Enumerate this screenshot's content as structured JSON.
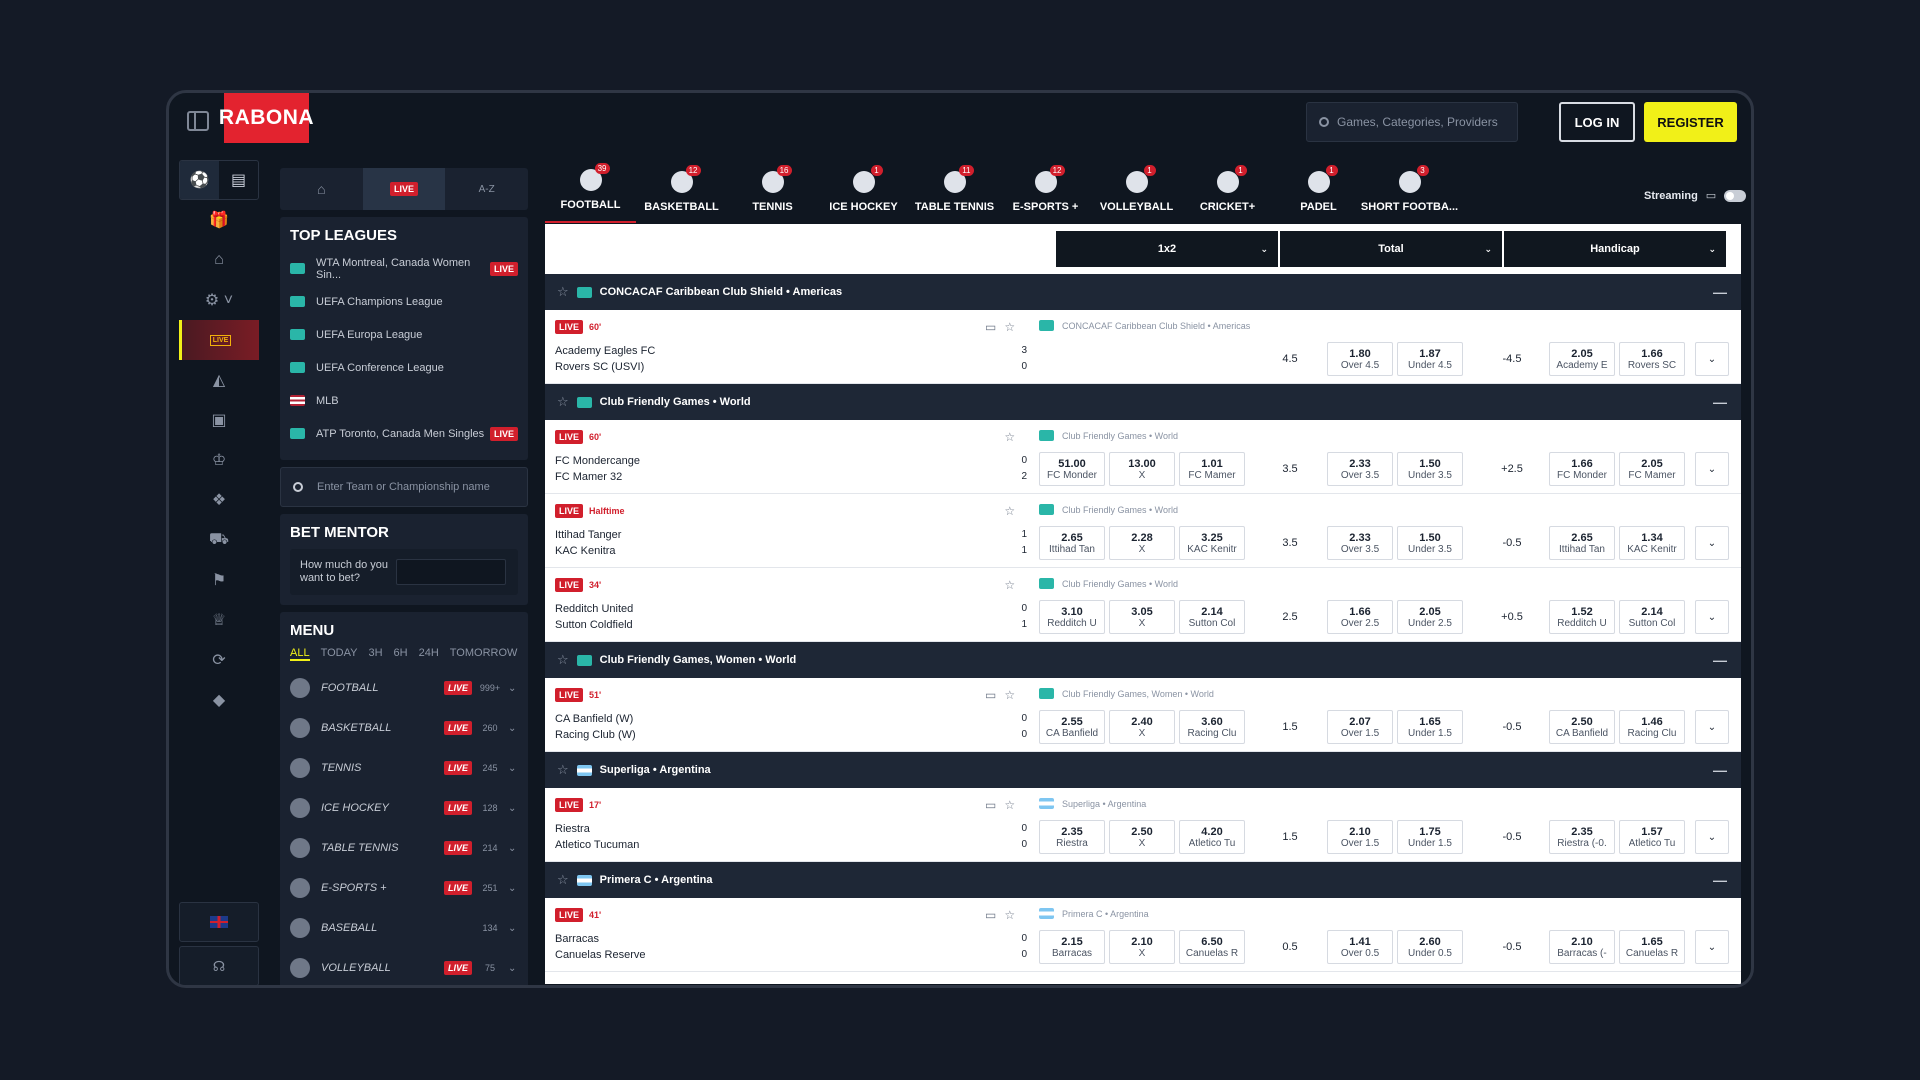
{
  "header": {
    "logo": "RABONA",
    "search_placeholder": "Games, Categories, Providers",
    "login": "LOG IN",
    "register": "REGISTER"
  },
  "sidebar": {
    "tabs": {
      "live": "LIVE",
      "az": "A-Z"
    },
    "top_leagues_title": "TOP LEAGUES",
    "top_leagues": [
      {
        "name": "WTA Montreal, Canada Women Sin...",
        "live": "LIVE"
      },
      {
        "name": "UEFA Champions League",
        "live": ""
      },
      {
        "name": "UEFA Europa League",
        "live": ""
      },
      {
        "name": "UEFA Conference League",
        "live": ""
      },
      {
        "name": "MLB",
        "live": ""
      },
      {
        "name": "ATP Toronto, Canada Men Singles",
        "live": "LIVE"
      }
    ],
    "team_search_placeholder": "Enter Team or Championship name",
    "bet_mentor_title": "BET MENTOR",
    "bet_mentor_label": "How much do you want to bet?",
    "menu_title": "MENU",
    "menu_filters": [
      "ALL",
      "TODAY",
      "3H",
      "6H",
      "24H",
      "TOMORROW"
    ],
    "menu_items": [
      {
        "name": "FOOTBALL",
        "live": "LIVE",
        "count": "999+"
      },
      {
        "name": "BASKETBALL",
        "live": "LIVE",
        "count": "260"
      },
      {
        "name": "TENNIS",
        "live": "LIVE",
        "count": "245"
      },
      {
        "name": "ICE HOCKEY",
        "live": "LIVE",
        "count": "128"
      },
      {
        "name": "TABLE TENNIS",
        "live": "LIVE",
        "count": "214"
      },
      {
        "name": "E-SPORTS +",
        "live": "LIVE",
        "count": "251"
      },
      {
        "name": "BASEBALL",
        "live": "",
        "count": "134"
      },
      {
        "name": "VOLLEYBALL",
        "live": "LIVE",
        "count": "75"
      }
    ]
  },
  "sports": [
    {
      "label": "FOOTBALL",
      "badge": "39"
    },
    {
      "label": "BASKETBALL",
      "badge": "12"
    },
    {
      "label": "TENNIS",
      "badge": "16"
    },
    {
      "label": "ICE HOCKEY",
      "badge": "1"
    },
    {
      "label": "TABLE TENNIS",
      "badge": "11"
    },
    {
      "label": "E-SPORTS +",
      "badge": "12"
    },
    {
      "label": "VOLLEYBALL",
      "badge": "1"
    },
    {
      "label": "CRICKET+",
      "badge": "1"
    },
    {
      "label": "PADEL",
      "badge": "1"
    },
    {
      "label": "SHORT FOOTBA...",
      "badge": "3"
    }
  ],
  "streaming_label": "Streaming",
  "markets": [
    "1x2",
    "Total",
    "Handicap"
  ],
  "live_label": "LIVE",
  "groups": [
    {
      "league": "CONCACAF Caribbean Club Shield • Americas",
      "flag": "world",
      "matches": [
        {
          "time": "60'",
          "home": "Academy Eagles FC",
          "away": "Rovers SC (USVI)",
          "hs": "3",
          "as": "0",
          "meta": "CONCACAF Caribbean Club Shield • Americas",
          "tv": true,
          "x12": null,
          "total": [
            "4.5",
            "1.80",
            "Over 4.5",
            "1.87",
            "Under 4.5"
          ],
          "hcp": [
            "-4.5",
            "2.05",
            "Academy E",
            "1.66",
            "Rovers SC"
          ]
        }
      ]
    },
    {
      "league": "Club Friendly Games • World",
      "flag": "world",
      "matches": [
        {
          "time": "60'",
          "home": "FC Mondercange",
          "away": "FC Mamer 32",
          "hs": "0",
          "as": "2",
          "meta": "Club Friendly Games • World",
          "tv": false,
          "x12": [
            "51.00",
            "FC Monder",
            "13.00",
            "X",
            "1.01",
            "FC Mamer"
          ],
          "total": [
            "3.5",
            "2.33",
            "Over 3.5",
            "1.50",
            "Under 3.5"
          ],
          "hcp": [
            "+2.5",
            "1.66",
            "FC Monder",
            "2.05",
            "FC Mamer"
          ]
        },
        {
          "time": "Halftime",
          "home": "Ittihad Tanger",
          "away": "KAC Kenitra",
          "hs": "1",
          "as": "1",
          "meta": "Club Friendly Games • World",
          "tv": false,
          "x12": [
            "2.65",
            "Ittihad Tan",
            "2.28",
            "X",
            "3.25",
            "KAC Kenitr"
          ],
          "total": [
            "3.5",
            "2.33",
            "Over 3.5",
            "1.50",
            "Under 3.5"
          ],
          "hcp": [
            "-0.5",
            "2.65",
            "Ittihad Tan",
            "1.34",
            "KAC Kenitr"
          ]
        },
        {
          "time": "34'",
          "home": "Redditch United",
          "away": "Sutton Coldfield",
          "hs": "0",
          "as": "1",
          "meta": "Club Friendly Games • World",
          "tv": false,
          "x12": [
            "3.10",
            "Redditch U",
            "3.05",
            "X",
            "2.14",
            "Sutton Col"
          ],
          "total": [
            "2.5",
            "1.66",
            "Over 2.5",
            "2.05",
            "Under 2.5"
          ],
          "hcp": [
            "+0.5",
            "1.52",
            "Redditch U",
            "2.14",
            "Sutton Col"
          ]
        }
      ]
    },
    {
      "league": "Club Friendly Games, Women • World",
      "flag": "world",
      "matches": [
        {
          "time": "51'",
          "home": "CA Banfield (W)",
          "away": "Racing Club (W)",
          "hs": "0",
          "as": "0",
          "meta": "Club Friendly Games, Women • World",
          "tv": true,
          "x12": [
            "2.55",
            "CA Banfield",
            "2.40",
            "X",
            "3.60",
            "Racing Clu"
          ],
          "total": [
            "1.5",
            "2.07",
            "Over 1.5",
            "1.65",
            "Under 1.5"
          ],
          "hcp": [
            "-0.5",
            "2.50",
            "CA Banfield",
            "1.46",
            "Racing Clu"
          ]
        }
      ]
    },
    {
      "league": "Superliga • Argentina",
      "flag": "ar",
      "matches": [
        {
          "time": "17'",
          "home": "Riestra",
          "away": "Atletico Tucuman",
          "hs": "0",
          "as": "0",
          "meta": "Superliga • Argentina",
          "tv": true,
          "x12": [
            "2.35",
            "Riestra",
            "2.50",
            "X",
            "4.20",
            "Atletico Tu"
          ],
          "total": [
            "1.5",
            "2.10",
            "Over 1.5",
            "1.75",
            "Under 1.5"
          ],
          "hcp": [
            "-0.5",
            "2.35",
            "Riestra (-0.",
            "1.57",
            "Atletico Tu"
          ]
        }
      ]
    },
    {
      "league": "Primera C • Argentina",
      "flag": "ar",
      "matches": [
        {
          "time": "41'",
          "home": "Barracas",
          "away": "Canuelas Reserve",
          "hs": "0",
          "as": "0",
          "meta": "Primera C • Argentina",
          "tv": true,
          "x12": [
            "2.15",
            "Barracas",
            "2.10",
            "X",
            "6.50",
            "Canuelas R"
          ],
          "total": [
            "0.5",
            "1.41",
            "Over 0.5",
            "2.60",
            "Under 0.5"
          ],
          "hcp": [
            "-0.5",
            "2.10",
            "Barracas (-",
            "1.65",
            "Canuelas R"
          ]
        }
      ]
    }
  ]
}
